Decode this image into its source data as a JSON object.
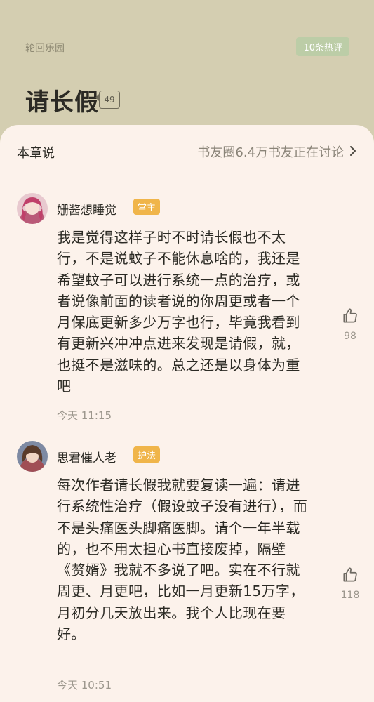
{
  "header": {
    "book_name": "轮回乐园",
    "hot_badge": "10条热评",
    "chapter_title": "请长假",
    "comment_count": "49"
  },
  "section": {
    "label": "本章说",
    "link": "书友圈6.4万书友正在讨论"
  },
  "comments": [
    {
      "username": "姗酱想睡觉",
      "role": "堂主",
      "text": "我是觉得这样子时不时请长假也不太行，不是说蚊子不能休息啥的，我还是希望蚊子可以进行系统一点的治疗，或者说像前面的读者说的你周更或者一个月保底更新多少万字也行，毕竟我看到有更新兴冲冲点进来发现是请假，就，也挺不是滋味的。总之还是以身体为重吧",
      "time": "今天 11:15",
      "likes": "98"
    },
    {
      "username": "思君催人老",
      "role": "护法",
      "text": "每次作者请长假我就要复读一遍：请进行系统性治疗（假设蚊子没有进行），而不是头痛医头脚痛医脚。请个一年半载的，也不用太担心书直接废掉，隔壁《赘婿》我就不多说了吧。实在不行就周更、月更吧，比如一月更新15万字，月初分几天放出来。我个人比现在要好。",
      "time": "今天 10:51",
      "likes": "118"
    }
  ],
  "colors": {
    "header_bg": "#d4ceb1",
    "sheet_bg": "#fcf2eb",
    "hot_badge_bg": "#bccda7",
    "role_badge_bg": "#f0b54a",
    "text": "#2b2a24",
    "muted": "#9b968c"
  },
  "icons": {
    "chevron": "chevron-right-icon",
    "like": "thumbs-up-icon"
  }
}
